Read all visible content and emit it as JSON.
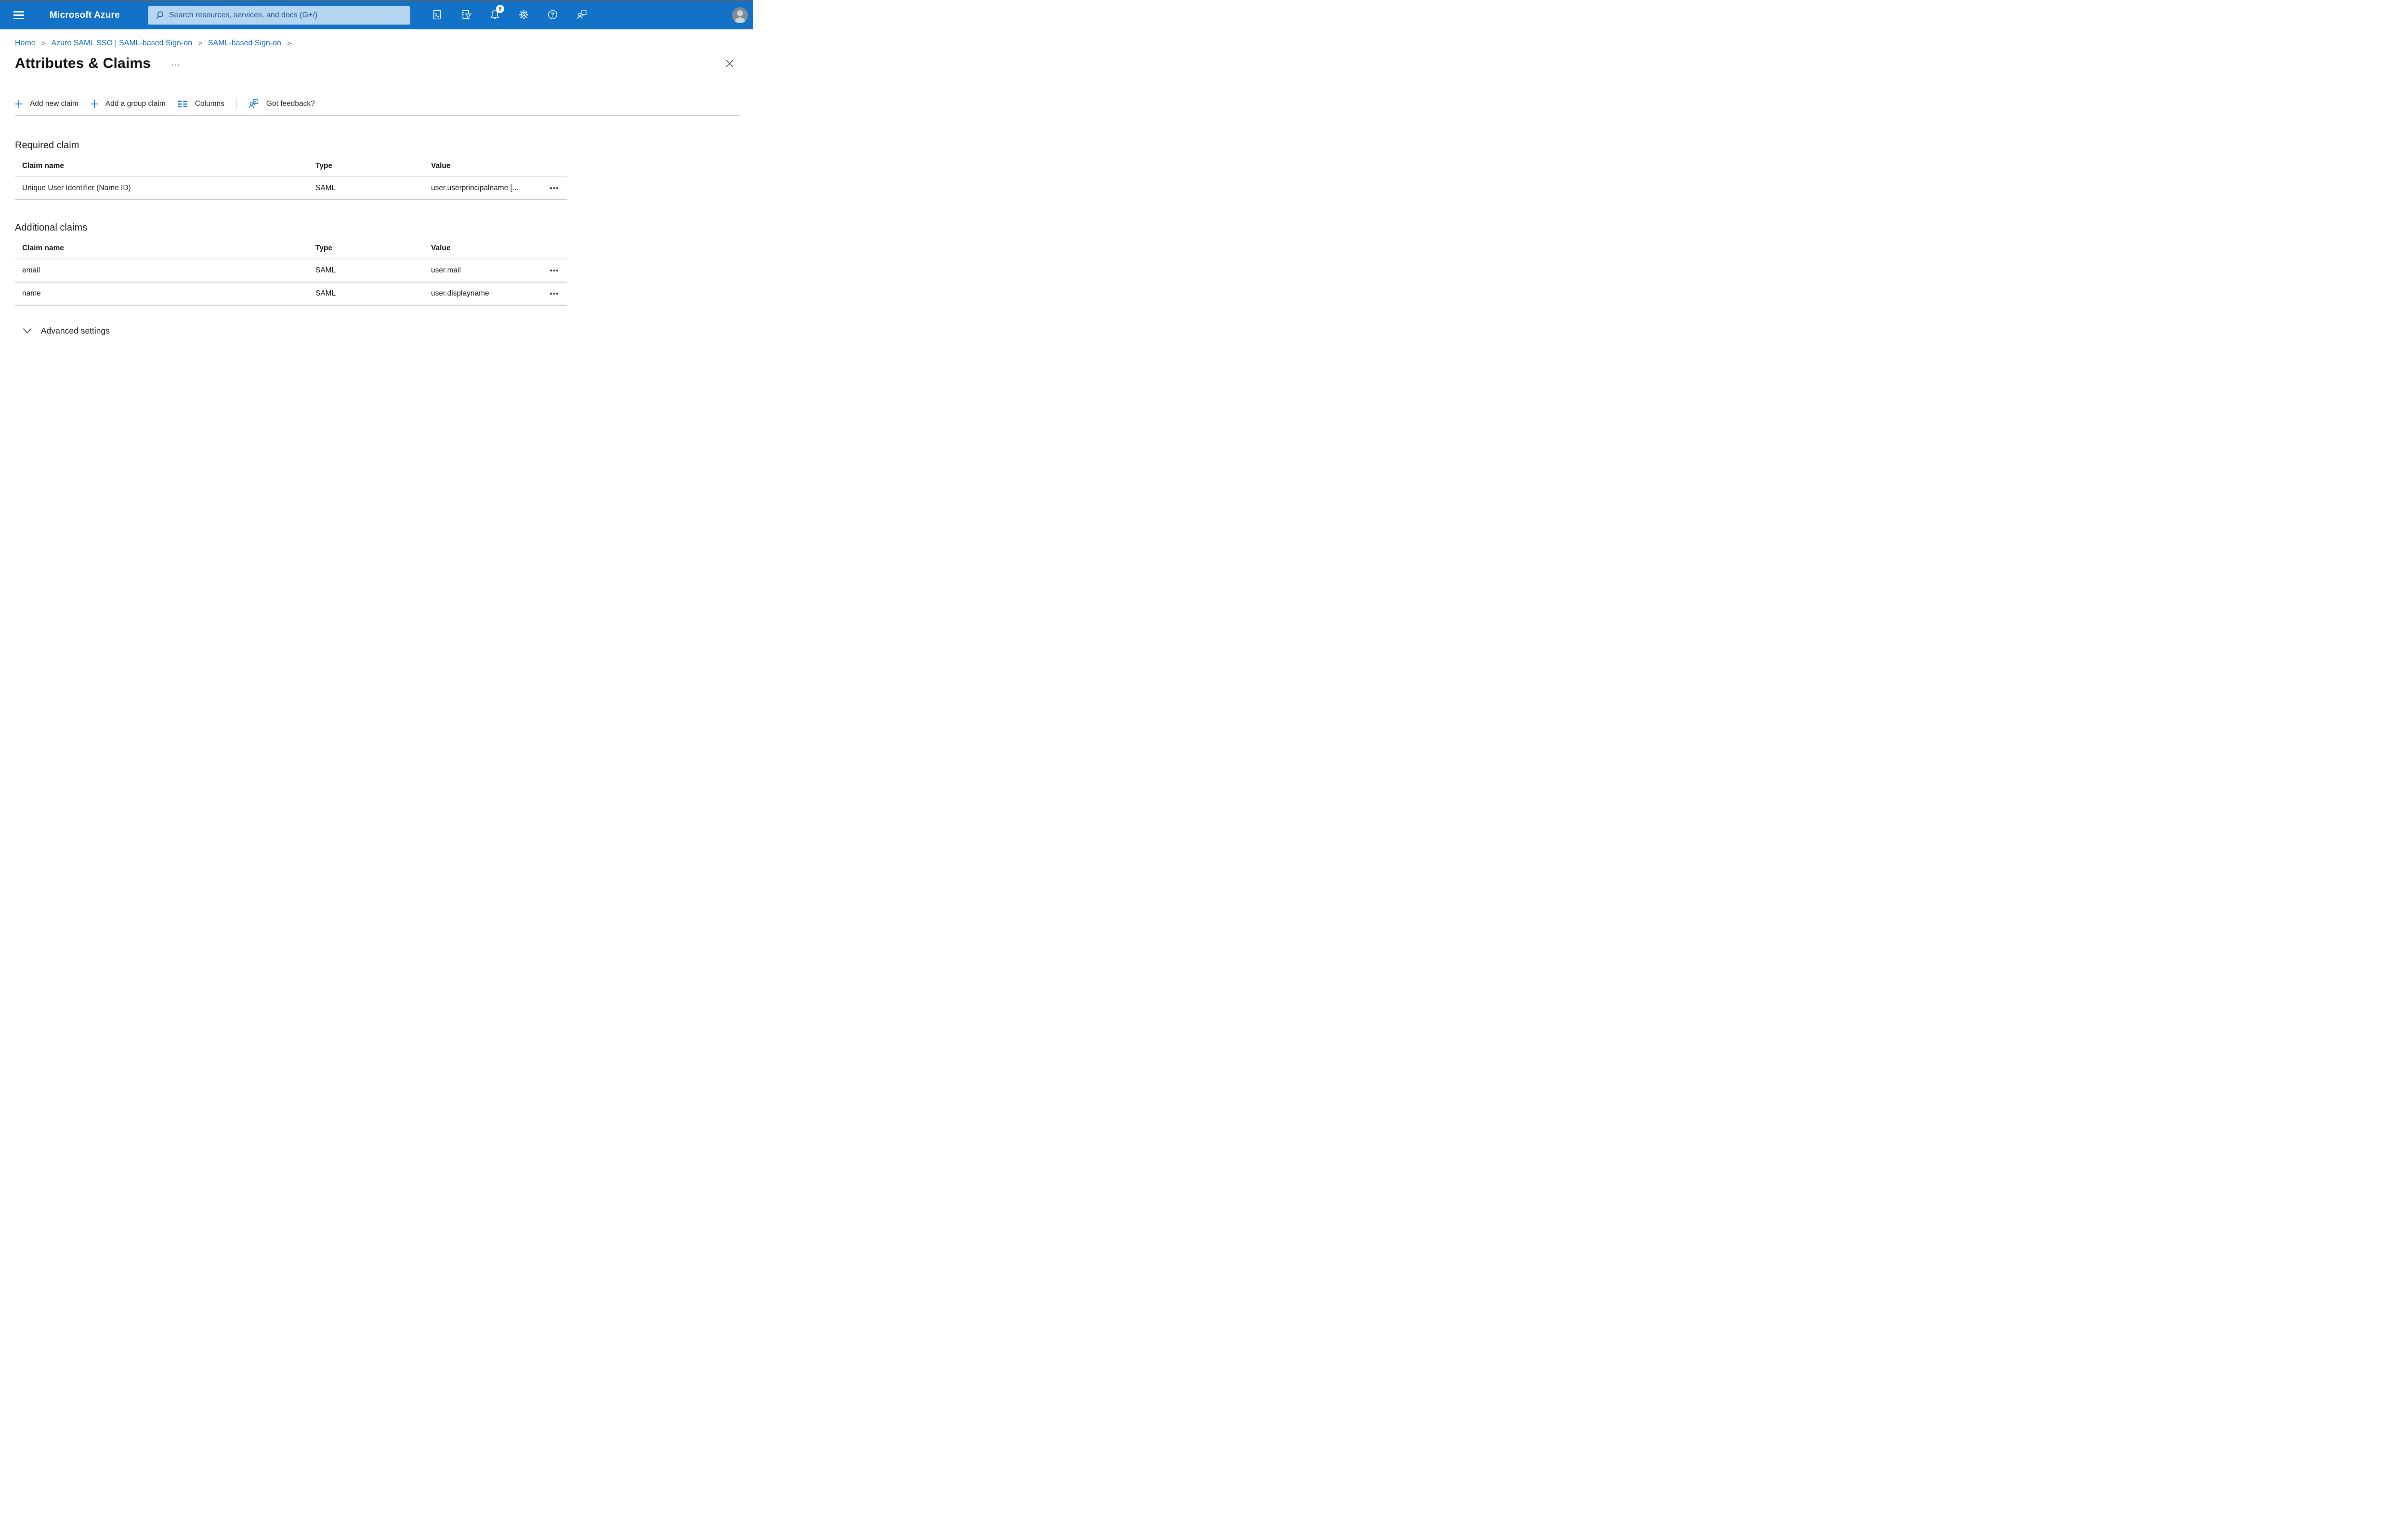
{
  "topbar": {
    "brand": "Microsoft Azure",
    "search_placeholder": "Search resources, services, and docs (G+/)",
    "notification_count": "6",
    "icon_names": [
      "cloud-shell-icon",
      "directory-filter-icon",
      "notifications-bell-icon",
      "settings-gear-icon",
      "help-icon",
      "feedback-icon",
      "avatar"
    ]
  },
  "breadcrumb": {
    "separator": ">",
    "items": [
      {
        "label": "Home"
      },
      {
        "label": "Azure SAML SSO | SAML-based Sign-on"
      },
      {
        "label": "SAML-based Sign-on"
      }
    ]
  },
  "page": {
    "title": "Attributes & Claims"
  },
  "toolbar": {
    "add_new_claim": "Add new claim",
    "add_group_claim": "Add a group claim",
    "columns": "Columns",
    "feedback": "Got feedback?"
  },
  "required_claim": {
    "heading": "Required claim",
    "columns": [
      "Claim name",
      "Type",
      "Value"
    ],
    "rows": [
      {
        "name": "Unique User Identifier (Name ID)",
        "type": "SAML",
        "value": "user.userprincipalname [..."
      }
    ]
  },
  "additional_claims": {
    "heading": "Additional claims",
    "columns": [
      "Claim name",
      "Type",
      "Value"
    ],
    "rows": [
      {
        "name": "email",
        "type": "SAML",
        "value": "user.mail"
      },
      {
        "name": "name",
        "type": "SAML",
        "value": "user.displayname"
      }
    ]
  },
  "advanced_settings": {
    "label": "Advanced settings"
  },
  "glyphs": {
    "help_mark": "?"
  },
  "colors": {
    "topbar_blue": "#1272c8",
    "search_bg": "#b6d5f0",
    "search_text": "#17568f",
    "link_blue": "#0d6fc9",
    "icon_blue": "#0f7bcc",
    "row_divider": "#c9c9c9",
    "header_divider": "#e9e9e9",
    "toolbar_divider": "#d2d2d2"
  }
}
